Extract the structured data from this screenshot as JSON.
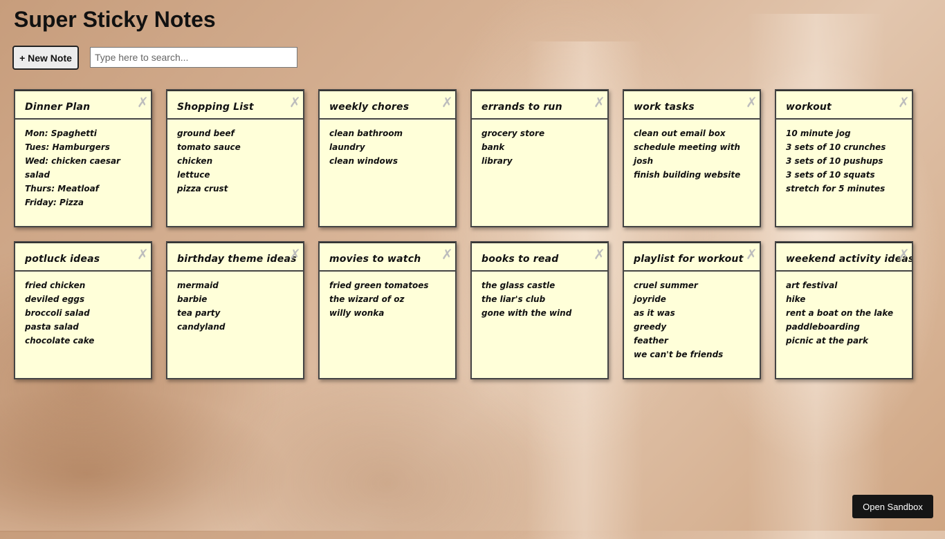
{
  "app": {
    "title": "Super Sticky Notes"
  },
  "toolbar": {
    "new_note_label": "+ New Note",
    "search_placeholder": "Type here to search..."
  },
  "notes": [
    {
      "title": "Dinner Plan",
      "lines": [
        "Mon: Spaghetti",
        "Tues: Hamburgers",
        "Wed: chicken caesar",
        "salad",
        "Thurs: Meatloaf",
        "Friday: Pizza"
      ]
    },
    {
      "title": "Shopping List",
      "lines": [
        "ground beef",
        "tomato sauce",
        "chicken",
        "lettuce",
        "pizza crust"
      ]
    },
    {
      "title": "weekly chores",
      "lines": [
        "clean bathroom",
        "laundry",
        "clean windows"
      ]
    },
    {
      "title": "errands to run",
      "lines": [
        "grocery store",
        "bank",
        "library"
      ]
    },
    {
      "title": "work tasks",
      "lines": [
        "clean out email box",
        "schedule meeting with",
        "josh",
        "finish building website"
      ]
    },
    {
      "title": "workout",
      "lines": [
        "10 minute jog",
        "3 sets of 10 crunches",
        "3 sets of 10 pushups",
        "3 sets of 10 squats",
        "stretch for 5 minutes"
      ]
    },
    {
      "title": "potluck ideas",
      "lines": [
        "fried chicken",
        "deviled eggs",
        "broccoli salad",
        "pasta salad",
        "chocolate cake"
      ]
    },
    {
      "title": "birthday theme ideas",
      "lines": [
        "mermaid",
        "barbie",
        "tea party",
        "candyland"
      ]
    },
    {
      "title": "movies to watch",
      "lines": [
        "fried green tomatoes",
        "the wizard of oz",
        "willy wonka"
      ]
    },
    {
      "title": "books to read",
      "lines": [
        "the glass castle",
        "the liar's club",
        "gone with the wind"
      ]
    },
    {
      "title": "playlist for workout",
      "lines": [
        "cruel summer",
        "joyride",
        "as it was",
        "greedy",
        "feather",
        "we can't be friends"
      ]
    },
    {
      "title": "weekend activity ideas",
      "lines": [
        "art festival",
        "hike",
        "rent a boat on the lake",
        "paddleboarding",
        "picnic at the park"
      ]
    }
  ],
  "close_glyph": "✗",
  "footer": {
    "sandbox_label": "Open Sandbox"
  }
}
